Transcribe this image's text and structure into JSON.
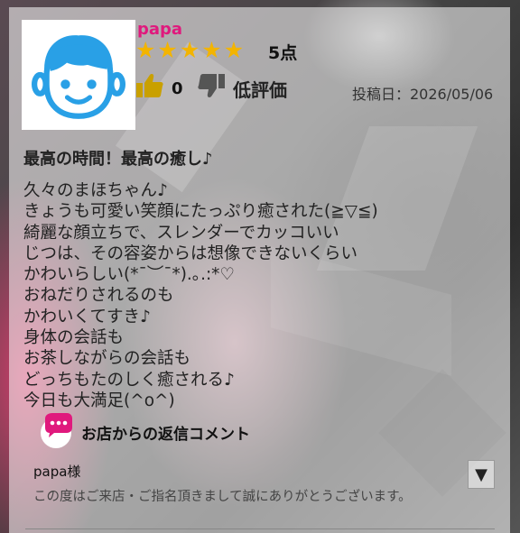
{
  "review": {
    "username": "papa",
    "stars": [
      "★",
      "★",
      "★",
      "★",
      "★"
    ],
    "rating_value": 5,
    "score_label": "5点",
    "likes": "0",
    "dislike_label": "低評価",
    "post_date": "投稿日：2026/05/06",
    "title": "最高の時間！最高の癒し♪",
    "body": "久々のまほちゃん♪\nきょうも可愛い笑顔にたっぷり癒された(≧▽≦)\n綺麗な顔立ちで、スレンダーでカッコいい\nじつは、その容姿からは想像できないくらい\nかわいらしい(*¯︶¯*).｡.:*♡\nおねだりされるのも\nかわいくてすき♪\n身体の会話も\nお茶しながらの会話も\nどっちもたのしく癒される♪\n今日も大満足(^o^)"
  },
  "reply": {
    "heading": "お店からの返信コメント",
    "recipient": "papa様",
    "text": "この度はご来店・ご指名頂きまして誠にありがとうございます。",
    "expand_icon": "▼"
  },
  "colors": {
    "username": "#e0197d",
    "star": "#f3b400",
    "avatar_face": "#29a0e6",
    "thumb_up": "#c9a000",
    "thumb_down": "#555555",
    "reply_bubble": "#e0197d"
  },
  "icons": {
    "avatar": "boy-face-avatar",
    "like": "thumbs-up-icon",
    "dislike": "thumbs-down-icon",
    "reply": "speech-bubble-icon"
  }
}
